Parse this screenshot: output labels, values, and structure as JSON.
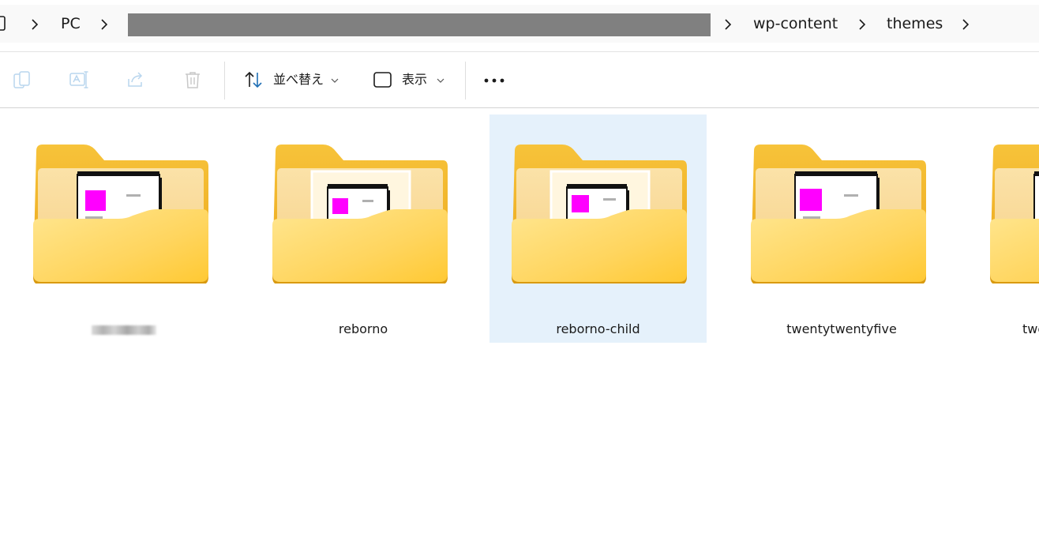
{
  "breadcrumb": {
    "items": [
      {
        "label": "PC"
      },
      {
        "label": ""
      },
      {
        "label": "wp-content"
      },
      {
        "label": "themes"
      }
    ]
  },
  "toolbar": {
    "sort_label": "並べ替え",
    "view_label": "表示",
    "actions": [
      "copy-icon",
      "rename-icon",
      "share-icon",
      "delete-icon",
      "sort-icon",
      "view-icon",
      "more-icon"
    ]
  },
  "folders": [
    {
      "name": "",
      "redacted": true,
      "selected": false
    },
    {
      "name": "reborno",
      "selected": false
    },
    {
      "name": "reborno-child",
      "selected": true
    },
    {
      "name": "twentytwentyfive",
      "selected": false
    },
    {
      "name": "twe",
      "selected": false
    }
  ],
  "colors": {
    "folder_back": "#f2b62a",
    "folder_front": "#ffd45c",
    "selection": "#e5f1fb",
    "toolbar_accent": "#1f6fb5",
    "magenta": "#ff00ff"
  }
}
